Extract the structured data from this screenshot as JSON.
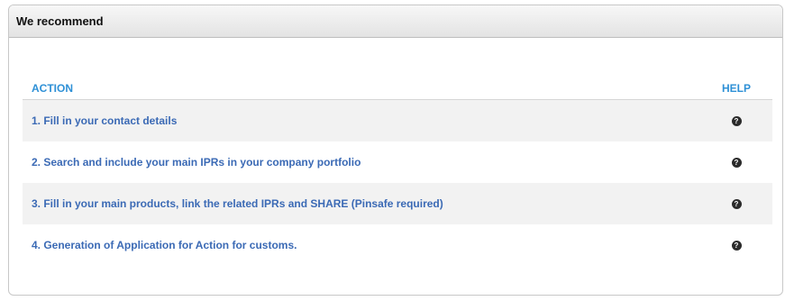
{
  "panel": {
    "title": "We recommend"
  },
  "table": {
    "headers": {
      "action": "ACTION",
      "help": "HELP"
    },
    "rows": [
      {
        "label": "1. Fill in your contact details",
        "help_icon": "question-circle-icon"
      },
      {
        "label": "2. Search and include your main IPRs in your company portfolio",
        "help_icon": "question-circle-icon"
      },
      {
        "label": "3. Fill in your main products, link the related IPRs and SHARE (Pinsafe required)",
        "help_icon": "question-circle-icon"
      },
      {
        "label": "4. Generation of Application for Action for customs.",
        "help_icon": "question-circle-icon"
      }
    ]
  },
  "colors": {
    "header_text": "#2e90d6",
    "link_text": "#3b6ab5",
    "alt_row_bg": "#f2f2f2"
  }
}
